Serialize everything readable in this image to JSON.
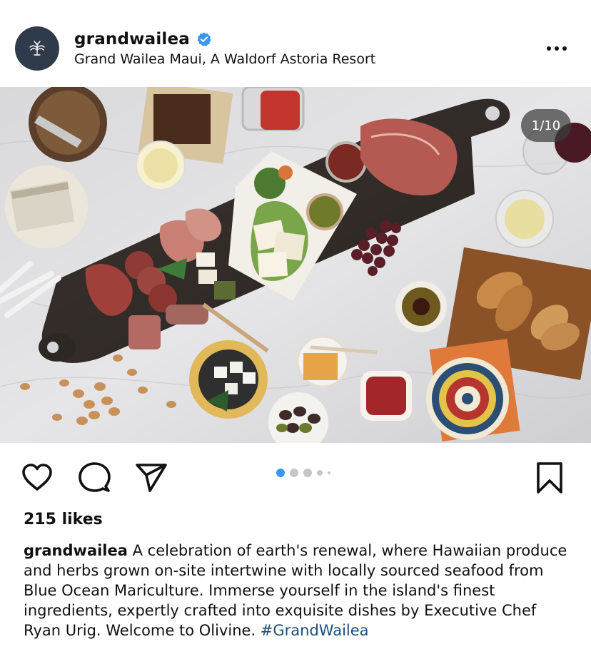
{
  "post": {
    "username": "grandwailea",
    "location": "Grand Wailea Maui, A Waldorf Astoria Resort",
    "verified": true,
    "image_counter": "1/10",
    "likes": "215 likes",
    "caption_user": "grandwailea",
    "caption_text": " A celebration of earth's renewal, where Hawaiian produce and herbs grown on-site intertwine with locally sourced seafood from Blue Ocean Mariculture. Immerse yourself in the island's finest ingredients, expertly crafted into exquisite dishes by Executive Chef Ryan Urig. Welcome to Olivine. ",
    "hashtag": "#GrandWailea"
  },
  "carousel": {
    "current": 1,
    "total": 10
  },
  "icons": {
    "avatar": "resort-logo-icon",
    "verified": "verified-badge-icon",
    "more": "more-options-icon",
    "like": "heart-icon",
    "comment": "comment-icon",
    "share": "send-icon",
    "save": "bookmark-icon"
  },
  "colors": {
    "verified": "#3897f0",
    "active_dot": "#3897f0",
    "hashtag": "#1d4f7c",
    "avatar_bg": "#2f3a4b"
  }
}
